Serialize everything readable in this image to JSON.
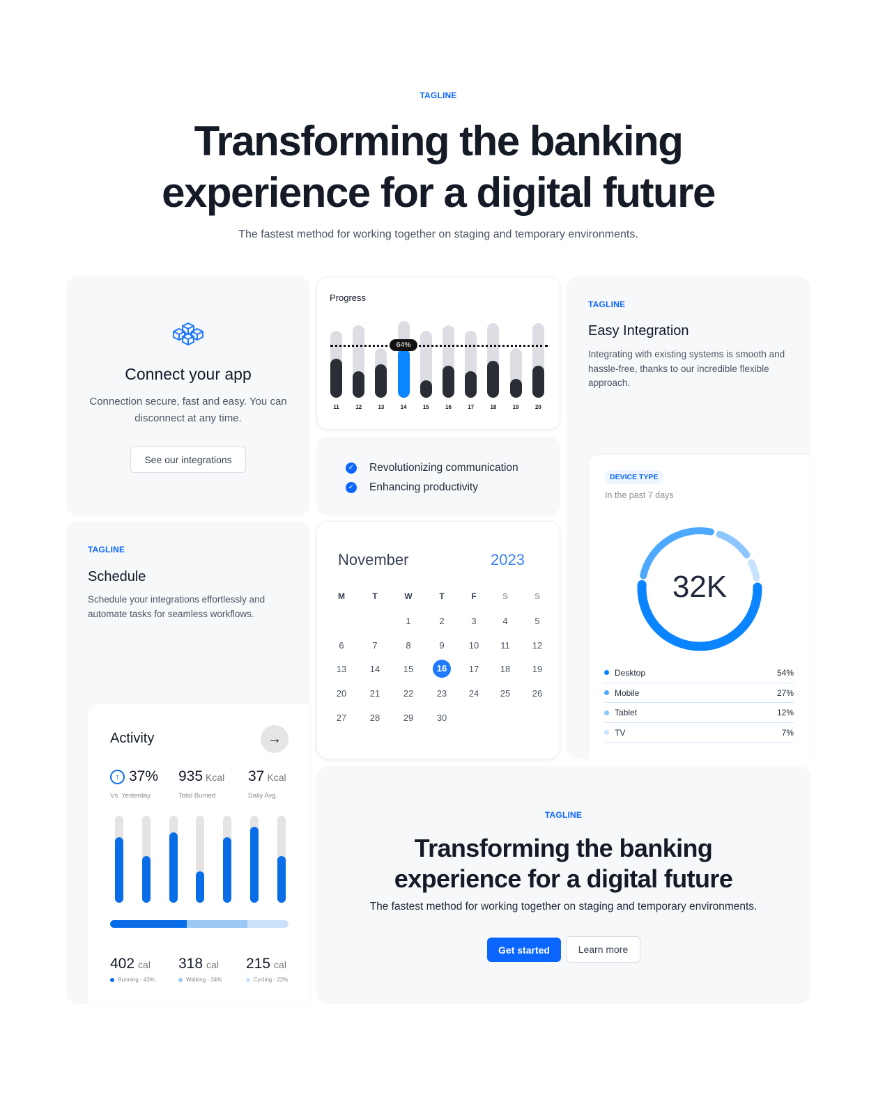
{
  "hero": {
    "tagline": "TAGLINE",
    "title_line1": "Transforming the banking",
    "title_line2": "experience for a digital future",
    "subtitle": "The fastest method for working together on staging and temporary environments."
  },
  "connect": {
    "icon": "cubes-icon",
    "title": "Connect your app",
    "description": "Connection secure, fast and easy. You can disconnect at any time.",
    "button": "See our integrations"
  },
  "progress": {
    "title": "Progress",
    "highlight_label": "64%",
    "colors": {
      "bar": "#2a2d34",
      "track": "#dcdee4",
      "highlight": "#0a84ff"
    },
    "chart_data": {
      "type": "bar",
      "categories": [
        "11",
        "12",
        "13",
        "14",
        "15",
        "16",
        "17",
        "18",
        "19",
        "20"
      ],
      "values": [
        51,
        35,
        44,
        64,
        23,
        42,
        35,
        48,
        25,
        42
      ],
      "track": [
        87,
        95,
        65,
        100,
        87,
        95,
        87,
        97,
        65,
        97
      ],
      "highlight_index": 3,
      "reference_line": 68
    }
  },
  "features": {
    "items": [
      "Revolutionizing communication",
      "Enhancing productivity"
    ]
  },
  "integration": {
    "tagline": "TAGLINE",
    "title": "Easy Integration",
    "description": "Integrating with existing systems is smooth and hassle-free, thanks to our incredible flexible approach."
  },
  "device": {
    "badge": "DEVICE TYPE",
    "subtitle": "In the past 7 days",
    "total": "32K",
    "chart_data": {
      "type": "pie",
      "categories": [
        "Desktop",
        "Mobile",
        "Tablet",
        "TV"
      ],
      "values": [
        54,
        27,
        12,
        7
      ],
      "labels": [
        "54%",
        "27%",
        "12%",
        "7%"
      ],
      "colors": [
        "#0a84ff",
        "#4da8ff",
        "#8ec7ff",
        "#c8e3ff"
      ]
    }
  },
  "schedule": {
    "tagline": "TAGLINE",
    "title": "Schedule",
    "description": "Schedule your integrations effortlessly and automate tasks for seamless workflows."
  },
  "calendar": {
    "month": "November",
    "year": "2023",
    "weekdays": [
      "M",
      "T",
      "W",
      "T",
      "F",
      "S",
      "S"
    ],
    "first_weekday": 2,
    "days": 30,
    "selected": 16
  },
  "activity": {
    "title": "Activity",
    "stats": [
      {
        "value": "37%",
        "unit": "",
        "label": "Vs. Yesterday"
      },
      {
        "value": "935",
        "unit": "Kcal",
        "label": "Total Burned"
      },
      {
        "value": "37",
        "unit": "Kcal",
        "label": "Daily Avg."
      }
    ],
    "chart_data": {
      "type": "bar",
      "values": [
        75,
        54,
        81,
        36,
        75,
        87,
        54
      ]
    },
    "breakdown": [
      {
        "value": "402",
        "unit": "cal",
        "label": "Running - 43%",
        "pct": 43,
        "color": "#0a6de8"
      },
      {
        "value": "318",
        "unit": "cal",
        "label": "Walking - 34%",
        "pct": 34,
        "color": "#9cc8f5"
      },
      {
        "value": "215",
        "unit": "cal",
        "label": "Cycling - 22%",
        "pct": 23,
        "color": "#cbe1fa"
      }
    ]
  },
  "cta": {
    "tagline": "TAGLINE",
    "title_line1": "Transforming the banking",
    "title_line2": "experience for a digital future",
    "subtitle": "The fastest method for working together on staging and temporary environments.",
    "primary": "Get started",
    "secondary": "Learn more"
  }
}
